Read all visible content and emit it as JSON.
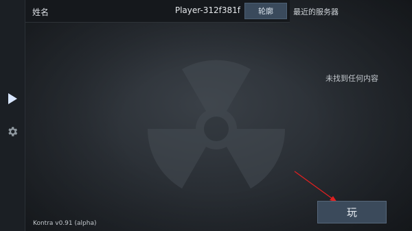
{
  "sidebar": {
    "play_icon": "play-icon",
    "settings_icon": "gear-icon"
  },
  "topbar": {
    "name_label": "姓名",
    "player_name": "Player-312f381f",
    "profile_button": "轮廓"
  },
  "servers": {
    "title": "最近的服务器",
    "empty_text": "未找到任何内容"
  },
  "footer": {
    "version": "Kontra v0.91 (alpha)"
  },
  "play_button": {
    "label": "玩"
  },
  "colors": {
    "accent": "#3b4a5b",
    "arrow": "#e02020",
    "play_icon": "#d8e6ff"
  }
}
